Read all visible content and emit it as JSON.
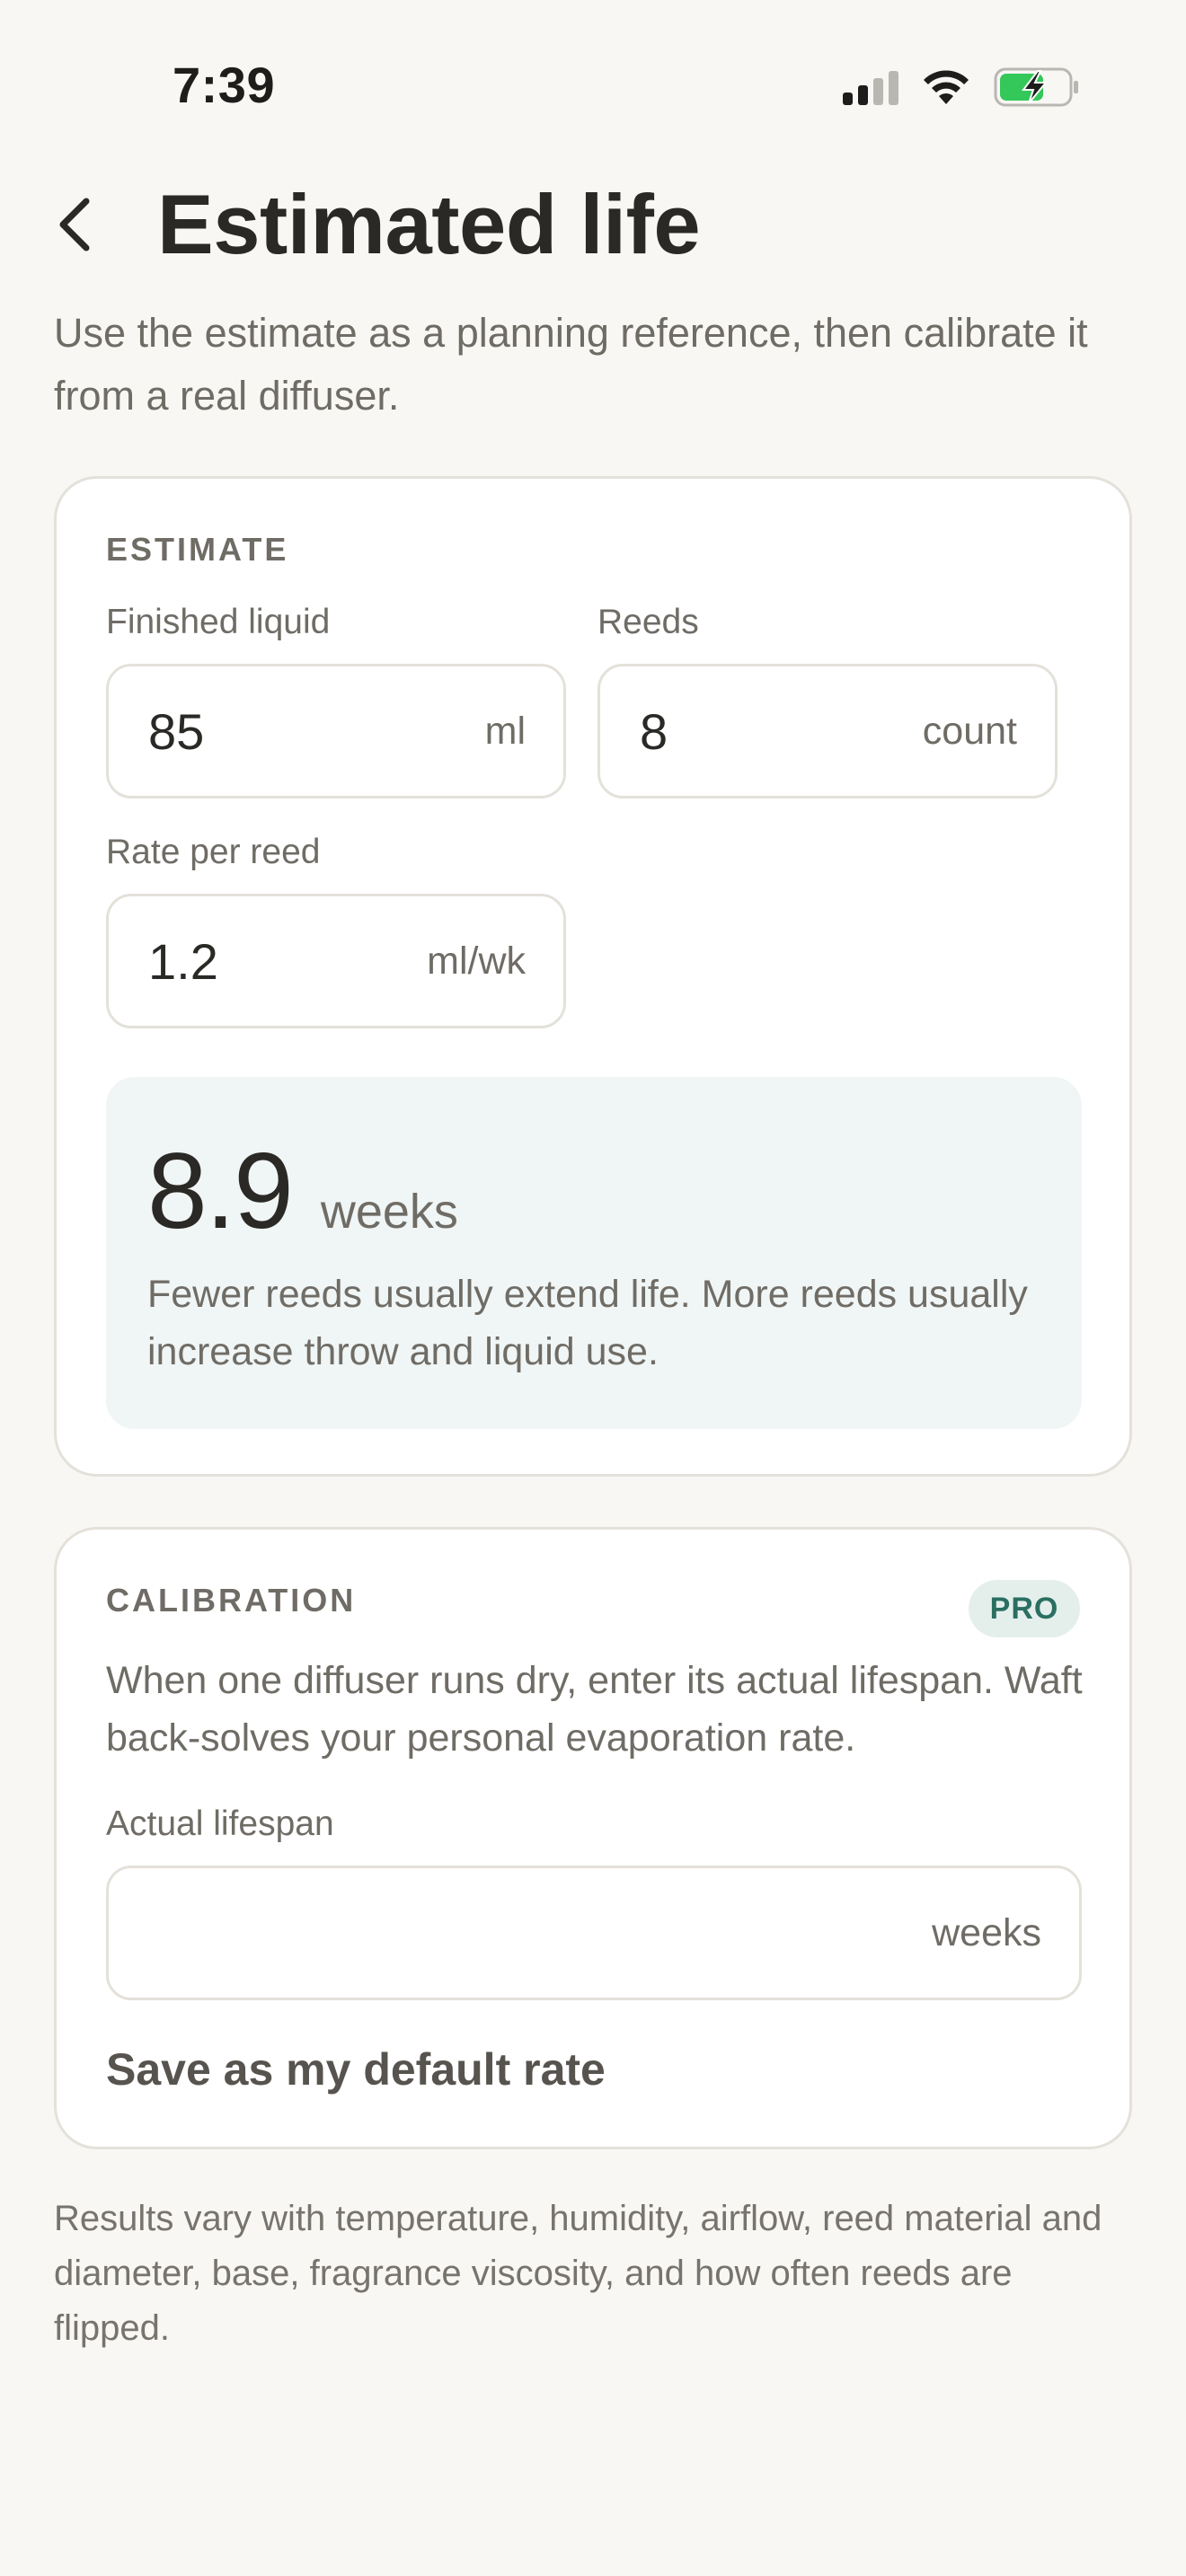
{
  "status_bar": {
    "time": "7:39",
    "icons": [
      "cellular-signal-icon",
      "wifi-icon",
      "battery-charging-icon"
    ],
    "battery_color": "#34c759"
  },
  "header": {
    "back_icon": "chevron-left-icon",
    "title": "Estimated life"
  },
  "intro": "Use the estimate as a planning reference, then calibrate it from a real diffuser.",
  "estimate": {
    "section_label": "ESTIMATE",
    "finished_liquid": {
      "label": "Finished liquid",
      "value": "85",
      "unit": "ml"
    },
    "reeds": {
      "label": "Reeds",
      "value": "8",
      "unit": "count"
    },
    "rate_per_reed": {
      "label": "Rate per reed",
      "value": "1.2",
      "unit": "ml/wk"
    },
    "result": {
      "value": "8.9",
      "unit": "weeks",
      "note": "Fewer reeds usually extend life. More reeds usually increase throw and liquid use."
    }
  },
  "calibration": {
    "section_label": "CALIBRATION",
    "badge": "PRO",
    "description": "When one diffuser runs dry, enter its actual lifespan. Waft back-solves your personal evaporation rate.",
    "actual_lifespan": {
      "label": "Actual lifespan",
      "value": "",
      "unit": "weeks"
    },
    "save_label": "Save as my default rate"
  },
  "footnote": "Results vary with temperature, humidity, airflow, reed material and diameter, base, fragrance viscosity, and how often reeds are flipped.",
  "colors": {
    "background": "#f8f7f4",
    "card": "#ffffff",
    "border": "#e4e1da",
    "result_bg": "#f0f5f5",
    "badge_bg": "#e4efec",
    "badge_text": "#2a6f62"
  }
}
